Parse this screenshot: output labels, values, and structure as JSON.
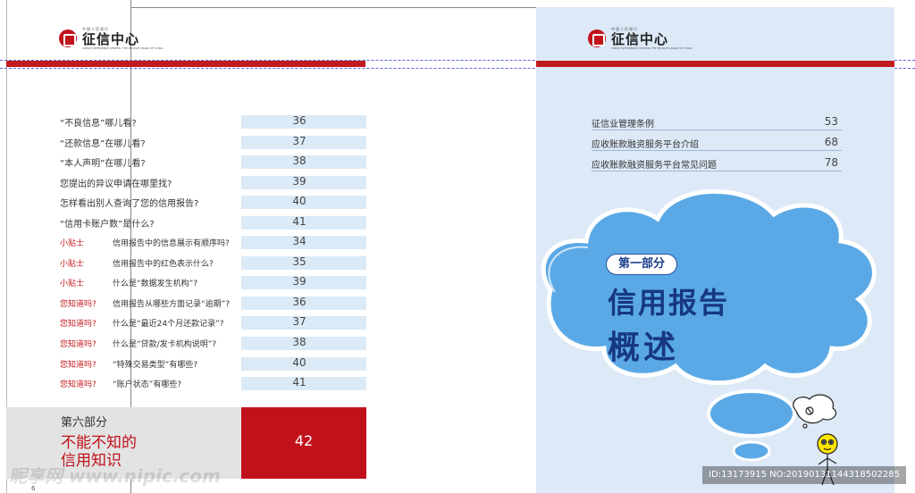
{
  "logo": {
    "small_text": "中国人民银行",
    "main_text": "征信中心",
    "en_text": "CREDIT REFERENCE CENTER, THE PEOPLE'S BANK OF CHINA"
  },
  "toc_left": [
    {
      "label": "“不良信息”哪儿看?",
      "page": "36"
    },
    {
      "label": "“还款信息”在哪儿看?",
      "page": "37"
    },
    {
      "label": "“本人声明”在哪儿看?",
      "page": "38"
    },
    {
      "label": "您提出的异议申请在哪里找?",
      "page": "39"
    },
    {
      "label": "怎样看出别人查询了您的信用报告?",
      "page": "40"
    },
    {
      "label": "“信用卡账户数”是什么?",
      "page": "41"
    }
  ],
  "toc_tagged": [
    {
      "tag": "小贴士",
      "label": "信用报告中的信息展示有顺序吗?",
      "page": "34"
    },
    {
      "tag": "小贴士",
      "label": "信用报告中的红色表示什么?",
      "page": "35"
    },
    {
      "tag": "小贴士",
      "label": "什么是“数据发生机构”?",
      "page": "39"
    },
    {
      "tag": "您知道吗?",
      "label": "信用报告从哪些方面记录“逾期”?",
      "page": "36"
    },
    {
      "tag": "您知道吗?",
      "label": "什么是“最近24个月还款记录”?",
      "page": "37"
    },
    {
      "tag": "您知道吗?",
      "label": "什么是“贷款/发卡机构说明”?",
      "page": "38"
    },
    {
      "tag": "您知道吗?",
      "label": "“特殊交易类型”有哪些?",
      "page": "40"
    },
    {
      "tag": "您知道吗?",
      "label": "“账户状态”有哪些?",
      "page": "41"
    }
  ],
  "section6": {
    "part": "第六部分",
    "title_line1": "不能不知的",
    "title_line2": "信用知识",
    "page": "42"
  },
  "left_page_number": "6",
  "toc_right": [
    {
      "label": "征信业管理条例",
      "page": "53"
    },
    {
      "label": "应收账款融资服务平台介绍",
      "page": "68"
    },
    {
      "label": "应收账款融资服务平台常见问题",
      "page": "78"
    }
  ],
  "cover": {
    "part_label": "第一部分",
    "title_line1": "信用报告",
    "title_line2": "概述"
  },
  "watermark": {
    "left_text": "昵享网 www.nipic.com",
    "right_text": "ID:13173915 NO:20190131144318502285"
  },
  "colors": {
    "brand_red": "#c1121c",
    "toc_band": "#dbeaf7",
    "right_page_bg": "#dde9f7",
    "cloud_blue": "#5aa9e6",
    "title_navy": "#17387f"
  }
}
